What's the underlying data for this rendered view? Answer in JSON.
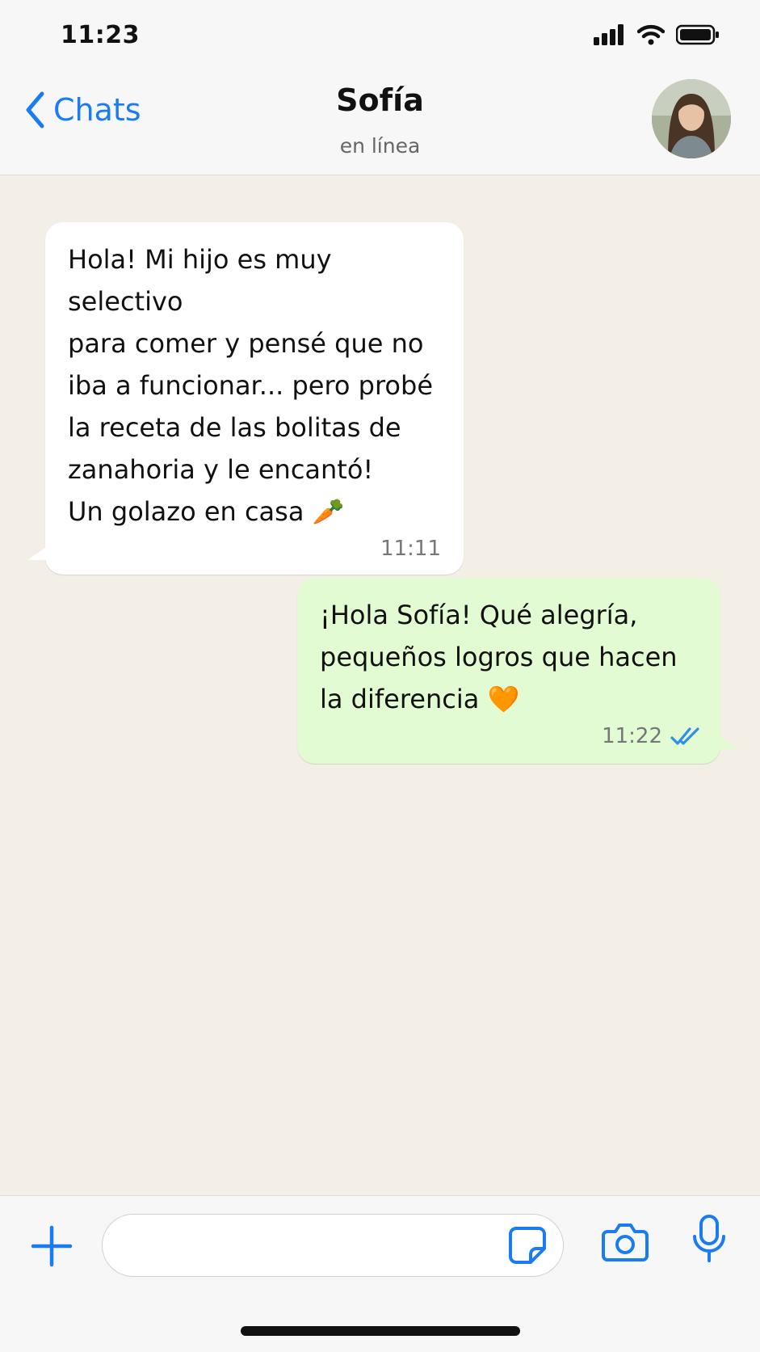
{
  "status_bar": {
    "time": "11:23"
  },
  "header": {
    "back_label": "Chats",
    "contact_name": "Sofía",
    "contact_status": "en línea"
  },
  "messages": [
    {
      "direction": "incoming",
      "text": "Hola! Mi hijo es muy selectivo\npara comer y pensé que no\niba a funcionar... pero probé\nla receta de las bolitas de\nzanahoria y le encantó!\nUn golazo en casa 🥕",
      "time": "11:11"
    },
    {
      "direction": "outgoing",
      "text": "¡Hola Sofía! Qué alegría,\npequeños logros que hacen\nla diferencia 🧡",
      "time": "11:22",
      "read_icon": "double-check-icon"
    }
  ],
  "input": {
    "placeholder": ""
  },
  "colors": {
    "accent": "#1a7cf0",
    "incoming_bubble": "#ffffff",
    "outgoing_bubble": "#e3fbd2",
    "chat_background": "#f4efe6"
  },
  "icons": [
    "signal-icon",
    "wifi-icon",
    "battery-icon",
    "chevron-left-icon",
    "plus-icon",
    "sticker-icon",
    "camera-icon",
    "microphone-icon"
  ]
}
